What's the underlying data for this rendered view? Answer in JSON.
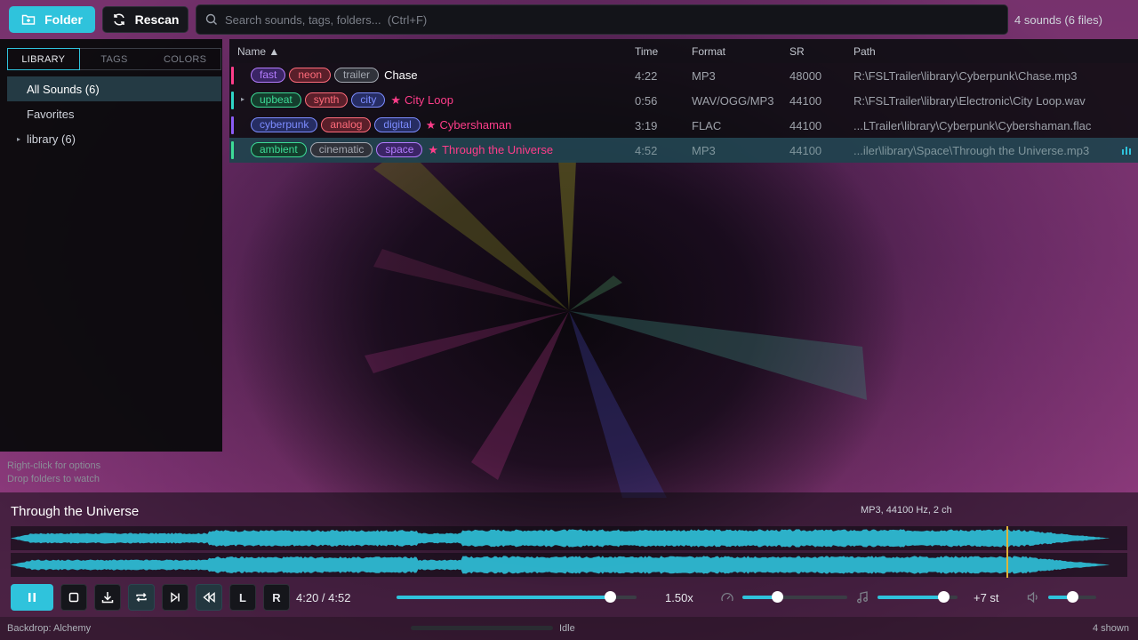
{
  "toolbar": {
    "folder_label": "Folder",
    "rescan_label": "Rescan",
    "search_placeholder": "Search sounds, tags, folders...  (Ctrl+F)",
    "sound_count": "4 sounds (6 files)"
  },
  "sidebar": {
    "tabs": [
      {
        "label": "LIBRARY",
        "active": true
      },
      {
        "label": "TAGS",
        "active": false
      },
      {
        "label": "COLORS",
        "active": false
      }
    ],
    "items": [
      {
        "label": "All Sounds  (6)",
        "active": true,
        "caret": false
      },
      {
        "label": "Favorites",
        "active": false,
        "caret": false
      },
      {
        "label": "library  (6)",
        "active": false,
        "caret": true
      }
    ],
    "hint_lines": [
      "Right-click for options",
      "Drop folders to watch"
    ]
  },
  "table": {
    "headers": {
      "name": "Name ▲",
      "time": "Time",
      "format": "Format",
      "sr": "SR",
      "path": "Path"
    },
    "rows": [
      {
        "bar_color": "#ff3d8a",
        "caret": false,
        "favorite": false,
        "selected": false,
        "tags": [
          {
            "label": "fast",
            "color": "#b47cff",
            "bg": "#3b2566"
          },
          {
            "label": "neon",
            "color": "#ff6b7a",
            "bg": "#5a1f2a"
          },
          {
            "label": "trailer",
            "color": "#a3a7b0",
            "bg": "#30323a"
          }
        ],
        "title": "Chase",
        "title_color": "#ffffff",
        "time": "4:22",
        "format": "MP3",
        "sr": "48000",
        "path": "R:\\FSLTrailer\\library\\Cyberpunk\\Chase.mp3"
      },
      {
        "bar_color": "#2fd4c6",
        "caret": true,
        "favorite": true,
        "selected": false,
        "tags": [
          {
            "label": "upbeat",
            "color": "#3ddc97",
            "bg": "#143d2d"
          },
          {
            "label": "synth",
            "color": "#ff6b7a",
            "bg": "#5a1f2a"
          },
          {
            "label": "city",
            "color": "#7c8cff",
            "bg": "#262d63"
          }
        ],
        "title": "City Loop",
        "title_color": "#ff3d8a",
        "time": "0:56",
        "format": "WAV/OGG/MP3",
        "sr": "44100",
        "path": "R:\\FSLTrailer\\library\\Electronic\\City Loop.wav"
      },
      {
        "bar_color": "#8b5cf6",
        "caret": false,
        "favorite": true,
        "selected": false,
        "tags": [
          {
            "label": "cyberpunk",
            "color": "#7c8cff",
            "bg": "#262d63"
          },
          {
            "label": "analog",
            "color": "#ff6b7a",
            "bg": "#5a1f2a"
          },
          {
            "label": "digital",
            "color": "#7c8cff",
            "bg": "#262d63"
          }
        ],
        "title": "Cybershaman",
        "title_color": "#ff3d8a",
        "time": "3:19",
        "format": "FLAC",
        "sr": "44100",
        "path": "...LTrailer\\library\\Cyberpunk\\Cybershaman.flac"
      },
      {
        "bar_color": "#3ddc97",
        "caret": false,
        "favorite": true,
        "selected": true,
        "tags": [
          {
            "label": "ambient",
            "color": "#3ddc97",
            "bg": "#143d2d"
          },
          {
            "label": "cinematic",
            "color": "#a3a7b0",
            "bg": "#30323a"
          },
          {
            "label": "space",
            "color": "#b47cff",
            "bg": "#3b2566"
          }
        ],
        "title": "Through the Universe",
        "title_color": "#ff3d8a",
        "time": "4:52",
        "format": "MP3",
        "sr": "44100",
        "path": "...iler\\library\\Space\\Through the Universe.mp3"
      }
    ],
    "favorite_glyph": "★"
  },
  "player": {
    "title": "Through the Universe",
    "info": "MP3, 44100 Hz, 2 ch",
    "progress": 0.892,
    "time_display": "4:20 / 4:52",
    "speed_label": "1.50x",
    "speed_level": 0.89,
    "rate_level": 0.33,
    "pitch_level": 0.82,
    "pitch_label": "+7 st",
    "volume_level": 0.5,
    "left_label": "L",
    "right_label": "R",
    "accent": "#2fc3dc"
  },
  "status": {
    "backdrop": "Backdrop: Alchemy",
    "state": "Idle",
    "shown": "4 shown"
  }
}
